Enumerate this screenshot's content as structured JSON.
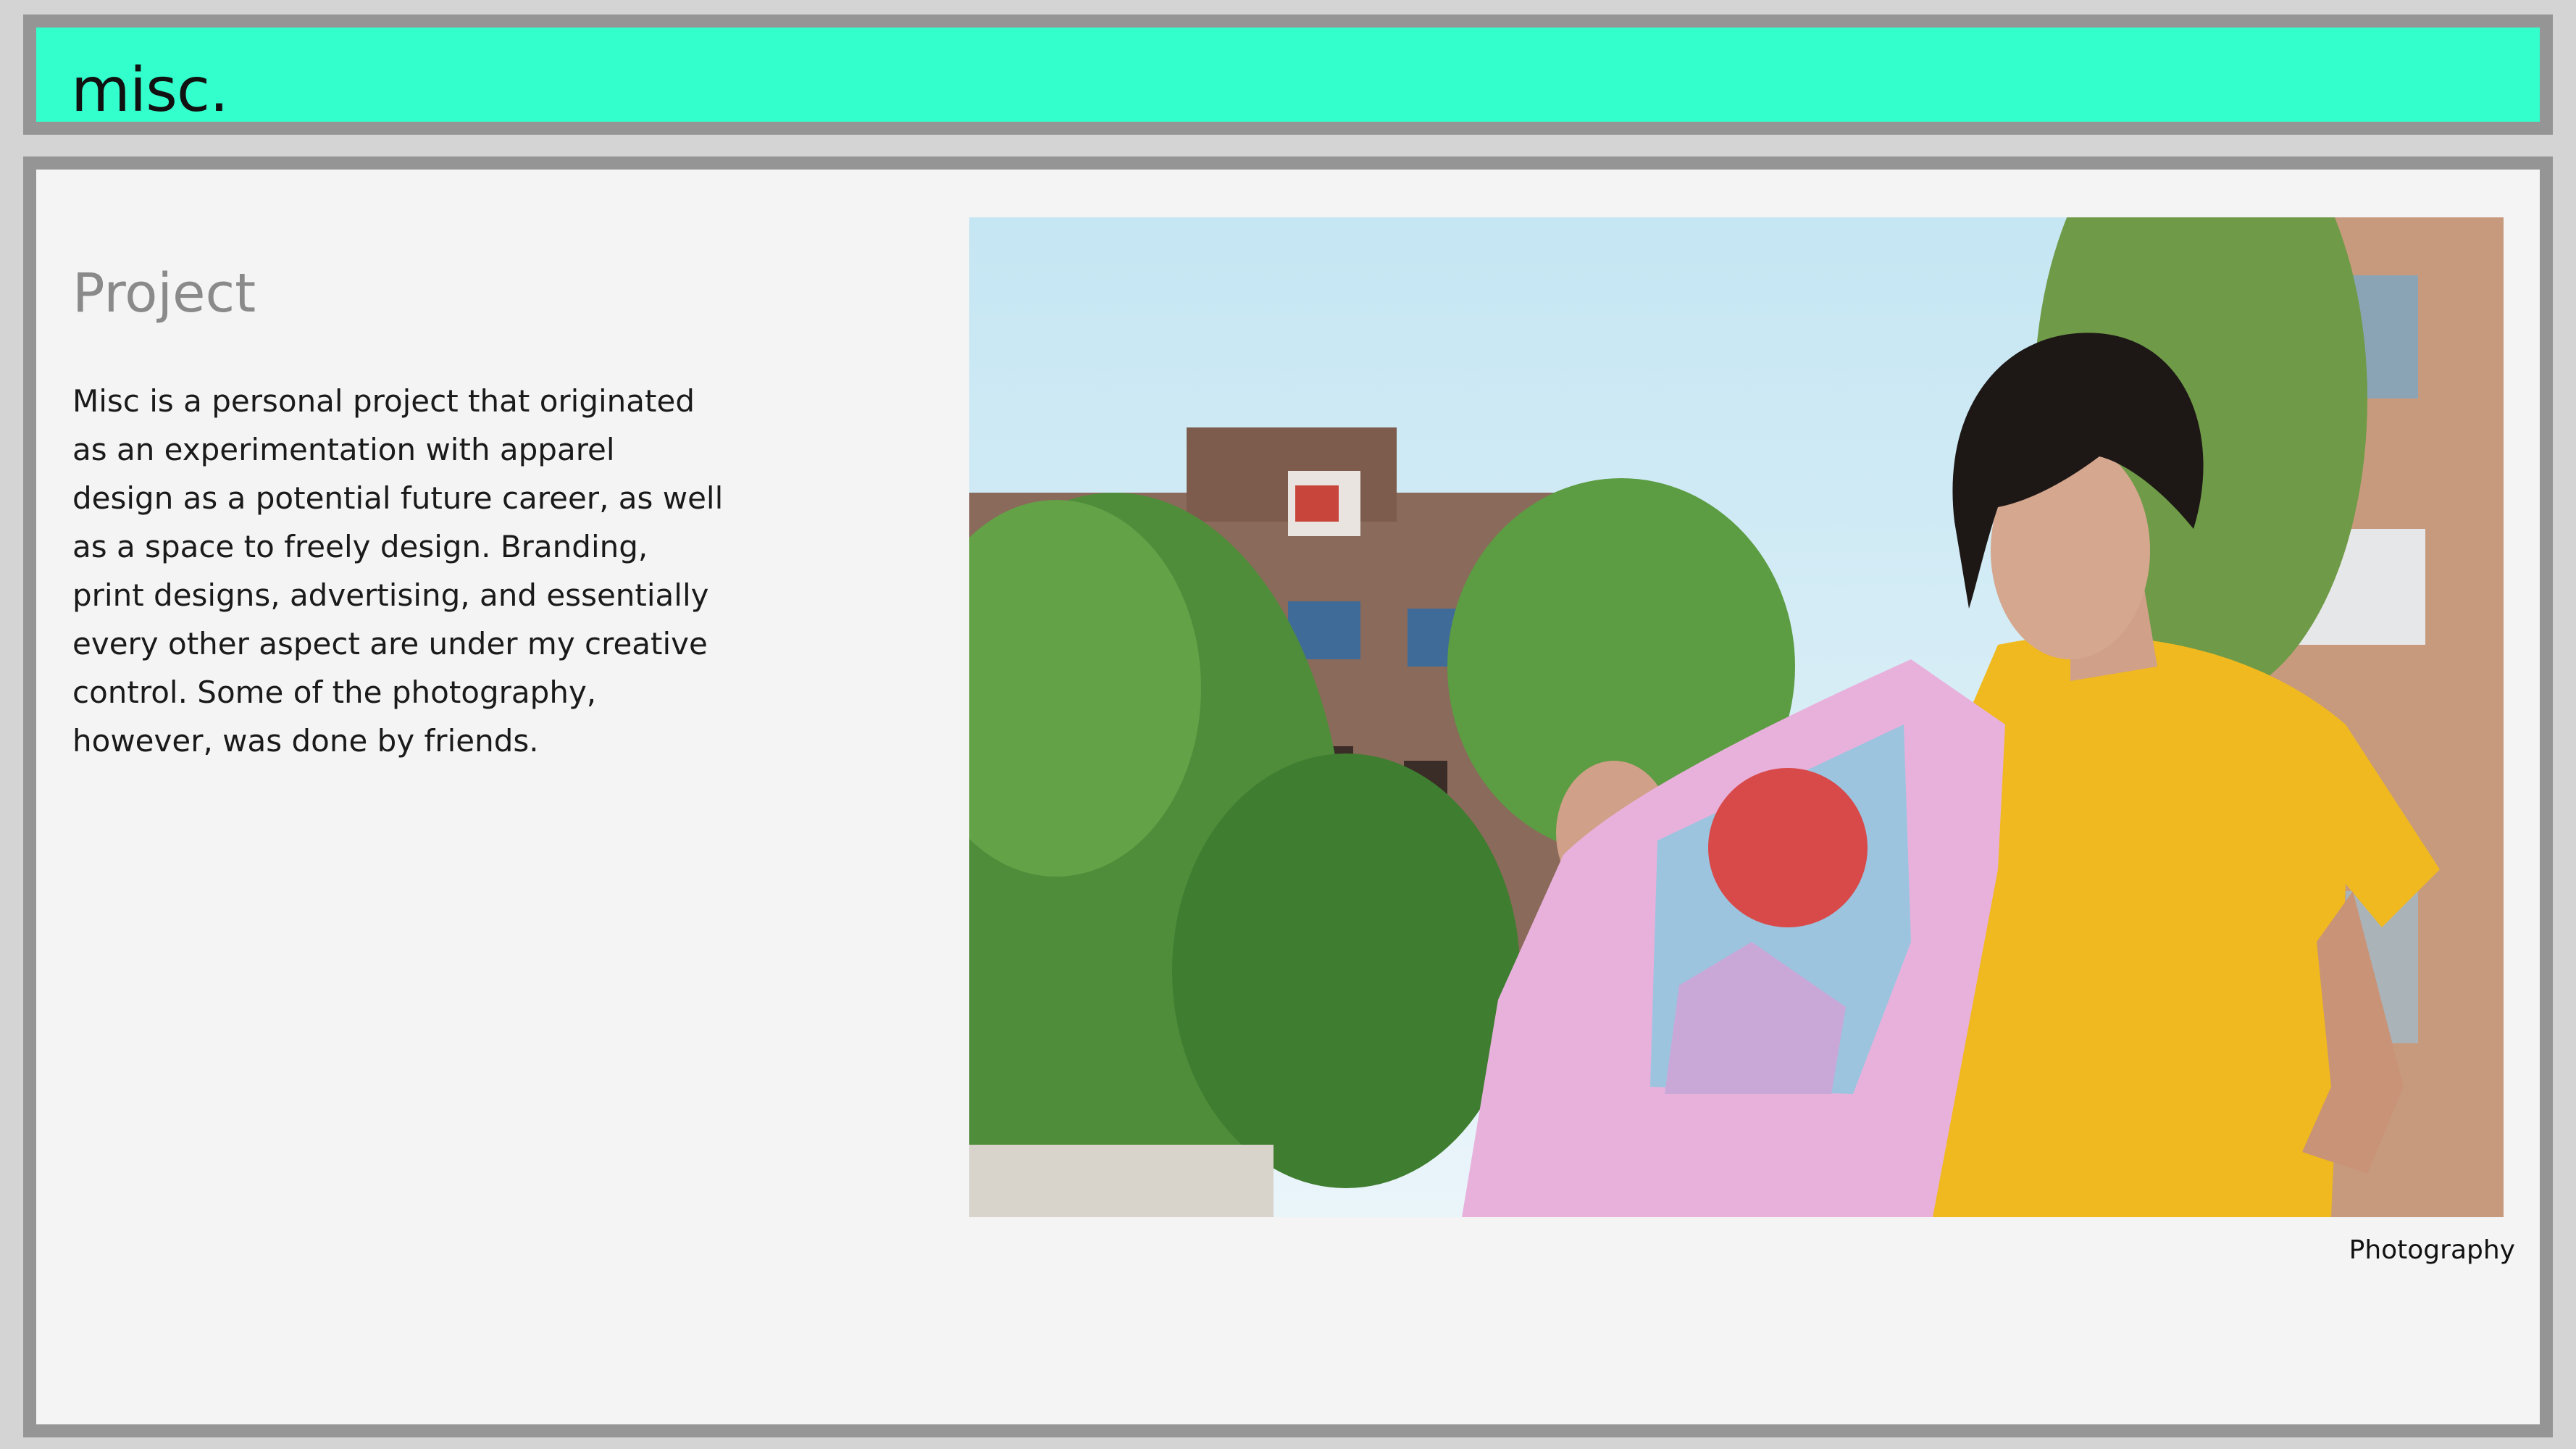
{
  "site": {
    "title": "misc."
  },
  "project": {
    "heading": "Project",
    "description": "Misc is a personal project that originated as an experimentation with apparel design as a potential future career, as well as a space to freely design. Branding, print designs, advertising, and essentially every other aspect are under my creative control. Some of the photography, however, was done by friends.",
    "image_caption": "Photography"
  },
  "colors": {
    "header_background": "#33ffcc",
    "frame_border": "#959595",
    "content_background": "#f4f4f4",
    "heading_text": "#8a8a8a",
    "body_text": "#1a1a1a"
  }
}
